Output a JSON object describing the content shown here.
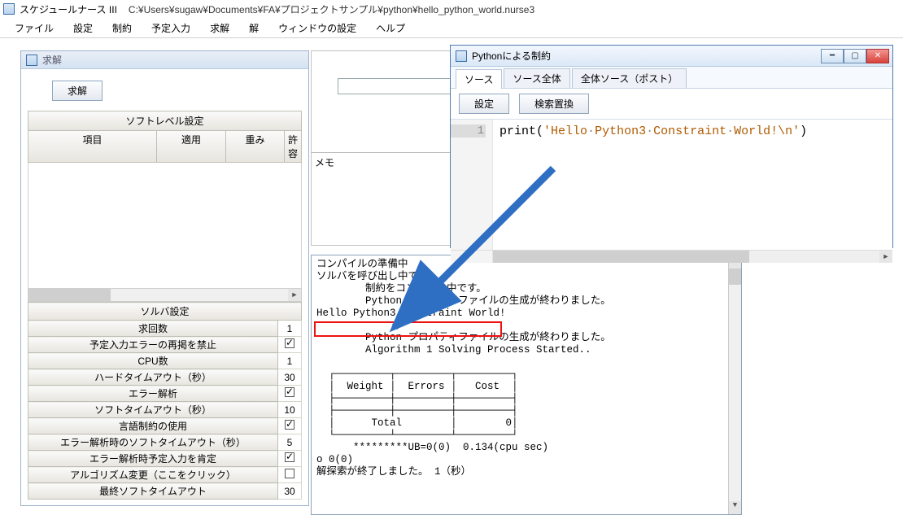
{
  "app": {
    "title": "スケジュールナース III",
    "path": "C:¥Users¥sugaw¥Documents¥FA¥プロジェクトサンプル¥python¥hello_python_world.nurse3"
  },
  "menu": [
    "ファイル",
    "設定",
    "制約",
    "予定入力",
    "求解",
    "解",
    "ウィンドウの設定",
    "ヘルプ"
  ],
  "left": {
    "title": "求解",
    "solve_btn": "求解",
    "soft_level_header": "ソフトレベル設定",
    "soft_cols": {
      "item": "項目",
      "apply": "適用",
      "weight": "重み",
      "allow": "許容"
    },
    "solver_header": "ソルバ設定",
    "rows": [
      {
        "label": "求回数",
        "val": "1",
        "chk": false
      },
      {
        "label": "予定入力エラーの再掲を禁止",
        "val": "",
        "chk": true
      },
      {
        "label": "CPU数",
        "val": "1",
        "chk": false
      },
      {
        "label": "ハードタイムアウト（秒）",
        "val": "30",
        "chk": false
      },
      {
        "label": "エラー解析",
        "val": "",
        "chk": true
      },
      {
        "label": "ソフトタイムアウト（秒）",
        "val": "10",
        "chk": false
      },
      {
        "label": "言語制約の使用",
        "val": "",
        "chk": true
      },
      {
        "label": "エラー解析時のソフトタイムアウト（秒）",
        "val": "5",
        "chk": false
      },
      {
        "label": "エラー解析時予定入力を肯定",
        "val": "",
        "chk": true
      },
      {
        "label": "アルゴリズム変更（ここをクリック）",
        "val": "",
        "chk": false
      },
      {
        "label": "最終ソフトタイムアウト",
        "val": "30",
        "chk": false
      }
    ]
  },
  "memo": {
    "label": "メモ"
  },
  "console_lines": [
    "コンパイルの準備中",
    "ソルバを呼び出し中です。",
    "        制約をコンパイル中です。",
    "        Python プロパティファイルの生成が終わりました。",
    "Hello Python3 Constraint World!",
    "",
    "        Python プロパティファイルの生成が終わりました。",
    "        Algorithm 1 Solving Process Started..",
    "",
    "  ┌─────────┬─────────┬─────────┐",
    "  │  Weight │  Errors │   Cost  │",
    "  ├─────────┼─────────┼─────────┤",
    "  ├─────────┼─────────┼─────────┤",
    "  │      Total        │        0│",
    "  └─────────┴─────────┴─────────┘",
    "      *********UB=0(0)  0.134(cpu sec)",
    "o 0(0)",
    "解探索が終了しました。 1（秒）"
  ],
  "pywin": {
    "title": "Pythonによる制約",
    "tabs": [
      "ソース",
      "ソース全体",
      "全体ソース（ポスト）"
    ],
    "active_tab": 0,
    "toolbar": {
      "settings": "設定",
      "findreplace": "検索置換"
    },
    "line_no": "1",
    "code": {
      "fn": "print",
      "str_full": "'Hello Python3 Constraint World!\\n'",
      "parts": [
        "'Hello",
        "Python3",
        "Constraint",
        "World!\\n'"
      ]
    }
  }
}
